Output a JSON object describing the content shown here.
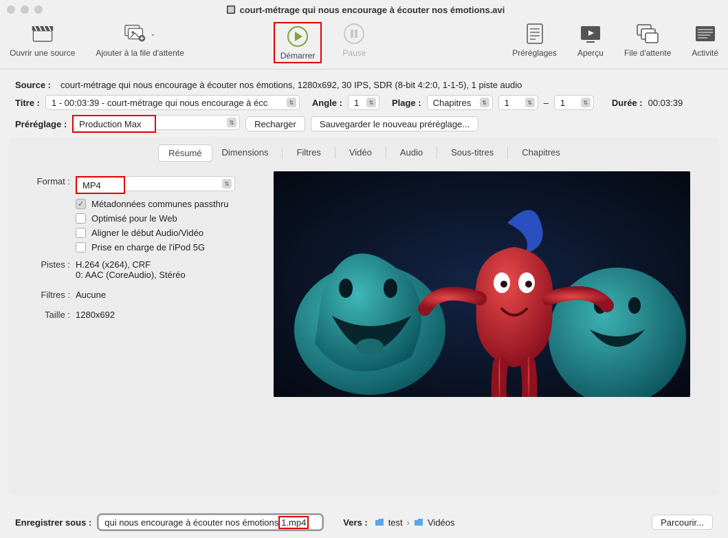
{
  "window": {
    "title": "court-métrage qui nous encourage à écouter nos émotions.avi"
  },
  "toolbar": {
    "open_source": "Ouvrir une source",
    "add_queue": "Ajouter à la file d'attente",
    "start": "Démarrer",
    "pause": "Pause",
    "presets": "Préréglages",
    "preview": "Aperçu",
    "queue": "File d'attente",
    "activity": "Activité"
  },
  "source": {
    "label": "Source :",
    "value": "court-métrage qui nous encourage à écouter nos émotions, 1280x692, 30 IPS, SDR (8-bit 4:2:0, 1-1-5), 1 piste audio"
  },
  "title_row": {
    "title_label": "Titre :",
    "title_value": "1 - 00:03:39 - court-métrage qui nous encourage à écc",
    "angle_label": "Angle :",
    "angle_value": "1",
    "range_label": "Plage :",
    "range_type": "Chapitres",
    "range_from": "1",
    "range_sep": "–",
    "range_to": "1",
    "duration_label": "Durée :",
    "duration_value": "00:03:39"
  },
  "preset_row": {
    "label": "Préréglage :",
    "value": "Production Max",
    "reload": "Recharger",
    "save_new": "Sauvegarder le nouveau préréglage..."
  },
  "tabs": {
    "summary": "Résumé",
    "dimensions": "Dimensions",
    "filters": "Filtres",
    "video": "Vidéo",
    "audio": "Audio",
    "subtitles": "Sous-titres",
    "chapters": "Chapitres"
  },
  "summary": {
    "format_label": "Format :",
    "format_value": "MP4",
    "chk_meta": "Métadonnées communes passthru",
    "chk_web": "Optimisé pour le Web",
    "chk_align": "Aligner le début Audio/Vidéo",
    "chk_ipod": "Prise en charge de l'iPod 5G",
    "tracks_label": "Pistes :",
    "tracks_value_l1": "H.264 (x264), CRF",
    "tracks_value_l2": "0: AAC (CoreAudio), Stéréo",
    "filters_label": "Filtres :",
    "filters_value": "Aucune",
    "size_label": "Taille :",
    "size_value": "1280x692"
  },
  "footer": {
    "save_label": "Enregistrer sous :",
    "filename_left": "qui nous encourage à écouter nos émotions ",
    "filename_ext": "1.mp4",
    "to_label": "Vers :",
    "path_seg1": "test",
    "path_sep": "›",
    "path_seg2": "Vidéos",
    "browse": "Parcourir..."
  }
}
